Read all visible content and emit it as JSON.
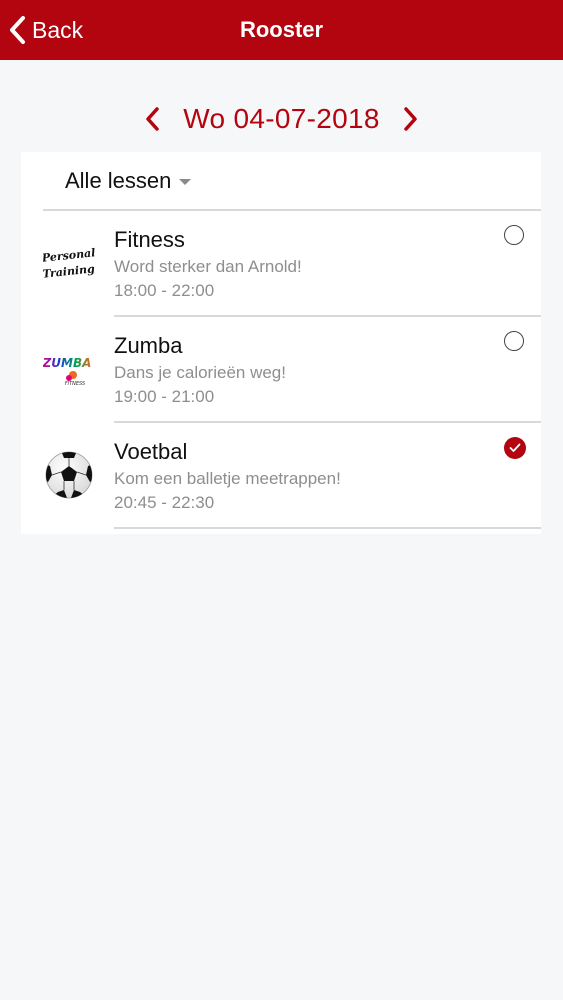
{
  "navbar": {
    "back_label": "Back",
    "title": "Rooster",
    "background_color": "#b3050f"
  },
  "date_nav": {
    "date": "Wo 04-07-2018",
    "prev_icon": "chevron-left-icon",
    "next_icon": "chevron-right-icon"
  },
  "filter": {
    "selected": "Alle lessen"
  },
  "lessons": [
    {
      "title": "Fitness",
      "subtitle": "Word sterker dan Arnold!",
      "time": "18:00 - 22:00",
      "logo_text_1": "Personal",
      "logo_text_2": "Training",
      "selected": false
    },
    {
      "title": "Zumba",
      "subtitle": "Dans je calorieën weg!",
      "time": "19:00 - 21:00",
      "logo_text_1": "ZUMBA",
      "logo_text_2": "FITNESS",
      "selected": false
    },
    {
      "title": "Voetbal",
      "subtitle": "Kom een balletje meetrappen!",
      "time": "20:45 - 22:30",
      "logo": "soccer-ball-icon",
      "selected": true
    }
  ],
  "colors": {
    "accent": "#b3050f",
    "background": "#f6f7f9",
    "secondary_text": "#8e8e8e"
  }
}
